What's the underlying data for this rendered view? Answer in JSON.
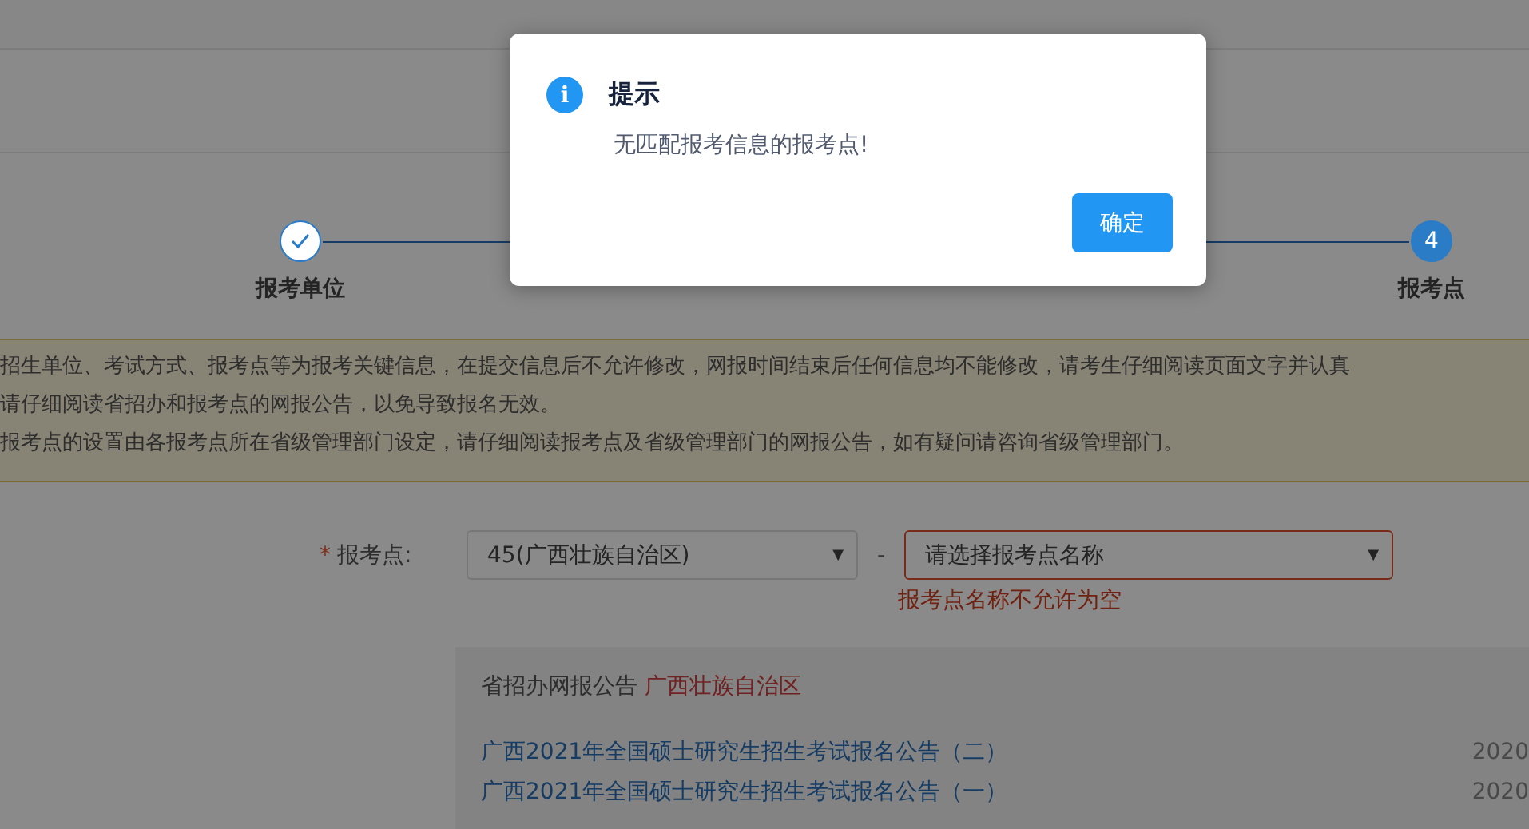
{
  "steps": [
    {
      "label": "报考单位",
      "done": true
    },
    {
      "label": "报考点",
      "number": "4",
      "done": false
    }
  ],
  "notice": {
    "lines": [
      "招生单位、考试方式、报考点等为报考关键信息，在提交信息后不允许修改，网报时间结束后任何信息均不能修改，请考生仔细阅读页面文字并认真",
      "请仔细阅读省招办和报考点的网报公告，以免导致报名无效。",
      "报考点的设置由各报考点所在省级管理部门设定，请仔细阅读报考点及省级管理部门的网报公告，如有疑问请咨询省级管理部门。"
    ]
  },
  "form": {
    "required_mark": "*",
    "label": "报考点:",
    "province_select": {
      "value": "45(广西壮族自治区)",
      "caret": "▼"
    },
    "separator": "-",
    "site_select": {
      "placeholder": "请选择报考点名称",
      "caret": "▼",
      "invalid": true
    },
    "error": "报考点名称不允许为空"
  },
  "announcements": {
    "title": "省招办网报公告",
    "province": "广西壮族自治区",
    "items": [
      {
        "title": "广西2021年全国硕士研究生招生考试报名公告（二）",
        "date": "2020"
      },
      {
        "title": "广西2021年全国硕士研究生招生考试报名公告（一）",
        "date": "2020"
      }
    ]
  },
  "dialog": {
    "icon": "i",
    "title": "提示",
    "message": "无匹配报考信息的报考点!",
    "button": "确定"
  }
}
